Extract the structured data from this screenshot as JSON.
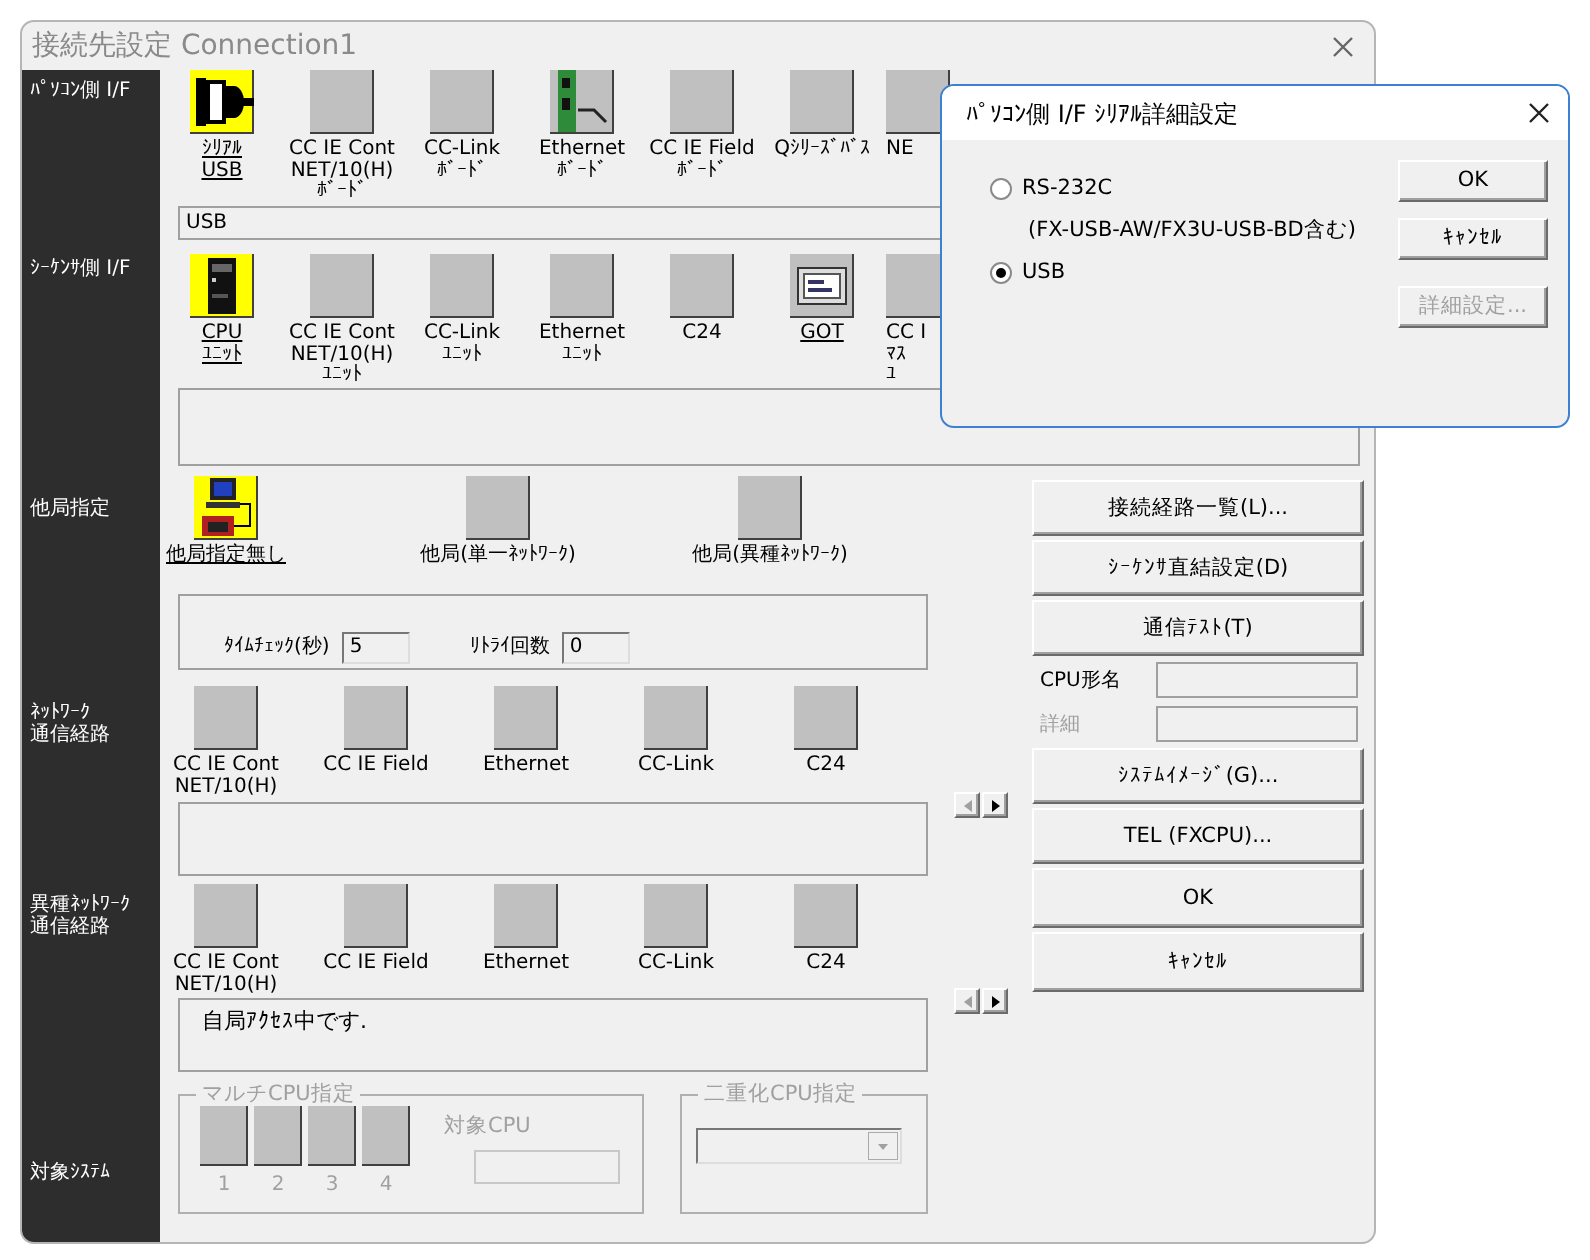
{
  "window": {
    "title": "接続先設定 Connection1"
  },
  "pc_interface": {
    "label": [
      "ﾊﾟｿｺﾝ側 I/F"
    ],
    "value": "USB",
    "items": [
      {
        "label": [
          "ｼﾘｱﾙ",
          "USB"
        ],
        "kind": "serial",
        "selected": true,
        "underlined": true
      },
      {
        "label": [
          "CC IE Cont",
          "NET/10(H)",
          "ﾎﾞｰﾄﾞ"
        ],
        "kind": "blank",
        "selected": false,
        "underlined": false
      },
      {
        "label": [
          "CC-Link",
          "ﾎﾞｰﾄﾞ"
        ],
        "kind": "blank",
        "selected": false,
        "underlined": false
      },
      {
        "label": [
          "Ethernet",
          "ﾎﾞｰﾄﾞ"
        ],
        "kind": "board",
        "selected": false,
        "underlined": false
      },
      {
        "label": [
          "CC IE Field",
          "ﾎﾞｰﾄﾞ"
        ],
        "kind": "blank",
        "selected": false,
        "underlined": false
      },
      {
        "label": [
          "Qｼﾘｰｽﾞﾊﾞｽ"
        ],
        "kind": "blank",
        "selected": false,
        "underlined": false
      },
      {
        "label": [
          "NE"
        ],
        "kind": "blank",
        "selected": false,
        "underlined": false
      }
    ]
  },
  "sequencer_interface": {
    "label": [
      "ｼｰｹﾝｻ側 I/F"
    ],
    "items": [
      {
        "label": [
          "CPU",
          "ﾕﾆｯﾄ"
        ],
        "kind": "cpu",
        "selected": true,
        "underlined": true
      },
      {
        "label": [
          "CC IE Cont",
          "NET/10(H)",
          "ﾕﾆｯﾄ"
        ],
        "kind": "blank",
        "selected": false,
        "underlined": false
      },
      {
        "label": [
          "CC-Link",
          "ﾕﾆｯﾄ"
        ],
        "kind": "blank",
        "selected": false,
        "underlined": false
      },
      {
        "label": [
          "Ethernet",
          "ﾕﾆｯﾄ"
        ],
        "kind": "blank",
        "selected": false,
        "underlined": false
      },
      {
        "label": [
          "C24"
        ],
        "kind": "blank",
        "selected": false,
        "underlined": false
      },
      {
        "label": [
          "GOT"
        ],
        "kind": "got",
        "selected": false,
        "underlined": true
      },
      {
        "label": [
          "CC I",
          "ﾏｽ",
          "ﾕ"
        ],
        "kind": "blank",
        "selected": false,
        "underlined": false
      }
    ]
  },
  "other_station": {
    "label": [
      "他局指定"
    ],
    "items": [
      {
        "label": [
          "他局指定無し"
        ],
        "kind": "station",
        "selected": true,
        "underlined": true
      },
      {
        "label": [
          "他局(単一ﾈｯﾄﾜｰｸ)"
        ],
        "kind": "blank",
        "selected": false,
        "underlined": false
      },
      {
        "label": [
          "他局(異種ﾈｯﾄﾜｰｸ)"
        ],
        "kind": "blank",
        "selected": false,
        "underlined": false
      }
    ],
    "time_check": {
      "label": "ﾀｲﾑﾁｪｯｸ(秒)",
      "value": "5"
    },
    "retry": {
      "label": "ﾘﾄﾗｲ回数",
      "value": "0"
    }
  },
  "network_route": {
    "label": [
      "ﾈｯﾄﾜｰｸ",
      "通信経路"
    ],
    "items": [
      {
        "label": [
          "CC IE Cont",
          "NET/10(H)"
        ],
        "kind": "blank",
        "selected": false,
        "underlined": false
      },
      {
        "label": [
          "CC IE Field"
        ],
        "kind": "blank",
        "selected": false,
        "underlined": false
      },
      {
        "label": [
          "Ethernet"
        ],
        "kind": "blank",
        "selected": false,
        "underlined": false
      },
      {
        "label": [
          "CC-Link"
        ],
        "kind": "blank",
        "selected": false,
        "underlined": false
      },
      {
        "label": [
          "C24"
        ],
        "kind": "blank",
        "selected": false,
        "underlined": false
      }
    ]
  },
  "hetero_network_route": {
    "label": [
      "異種ﾈｯﾄﾜｰｸ",
      "通信経路"
    ],
    "message": "自局ｱｸｾｽ中です.",
    "items": [
      {
        "label": [
          "CC IE Cont",
          "NET/10(H)"
        ],
        "kind": "blank",
        "selected": false,
        "underlined": false
      },
      {
        "label": [
          "CC IE Field"
        ],
        "kind": "blank",
        "selected": false,
        "underlined": false
      },
      {
        "label": [
          "Ethernet"
        ],
        "kind": "blank",
        "selected": false,
        "underlined": false
      },
      {
        "label": [
          "CC-Link"
        ],
        "kind": "blank",
        "selected": false,
        "underlined": false
      },
      {
        "label": [
          "C24"
        ],
        "kind": "blank",
        "selected": false,
        "underlined": false
      }
    ]
  },
  "target_system": {
    "label": [
      "対象ｼｽﾃﾑ"
    ],
    "multi_cpu": {
      "title": "マルチCPU指定",
      "disabled": true,
      "cpus": [
        "1",
        "2",
        "3",
        "4"
      ],
      "target_label": "対象CPU"
    },
    "redundant_cpu": {
      "title": "二重化CPU指定",
      "disabled": true
    }
  },
  "side_panel": [
    {
      "kind": "button",
      "label": "接続経路一覧(L)..."
    },
    {
      "kind": "button",
      "label": "ｼｰｹﾝｻ直結設定(D)"
    },
    {
      "kind": "button",
      "label": "通信ﾃｽﾄ(T)"
    },
    {
      "kind": "field",
      "label": "CPU形名",
      "disabled": false
    },
    {
      "kind": "field",
      "label": "詳細",
      "disabled": true
    },
    {
      "kind": "button",
      "label": "ｼｽﾃﾑｲﾒｰｼﾞ(G)..."
    },
    {
      "kind": "button",
      "label": "TEL (FXCPU)..."
    },
    {
      "kind": "button",
      "label": "OK"
    },
    {
      "kind": "button",
      "label": "ｷｬﾝｾﾙ"
    }
  ],
  "dialog": {
    "title": "ﾊﾟｿｺﾝ側 I/F ｼﾘｱﾙ詳細設定",
    "options": [
      {
        "label": "RS-232C",
        "note": "(FX-USB-AW/FX3U-USB-BD含む)",
        "selected": false
      },
      {
        "label": "USB",
        "selected": true
      }
    ],
    "buttons": [
      {
        "label": "OK",
        "disabled": false
      },
      {
        "label": "ｷｬﾝｾﾙ",
        "disabled": false
      },
      {
        "label": "詳細設定...",
        "disabled": true
      }
    ]
  }
}
